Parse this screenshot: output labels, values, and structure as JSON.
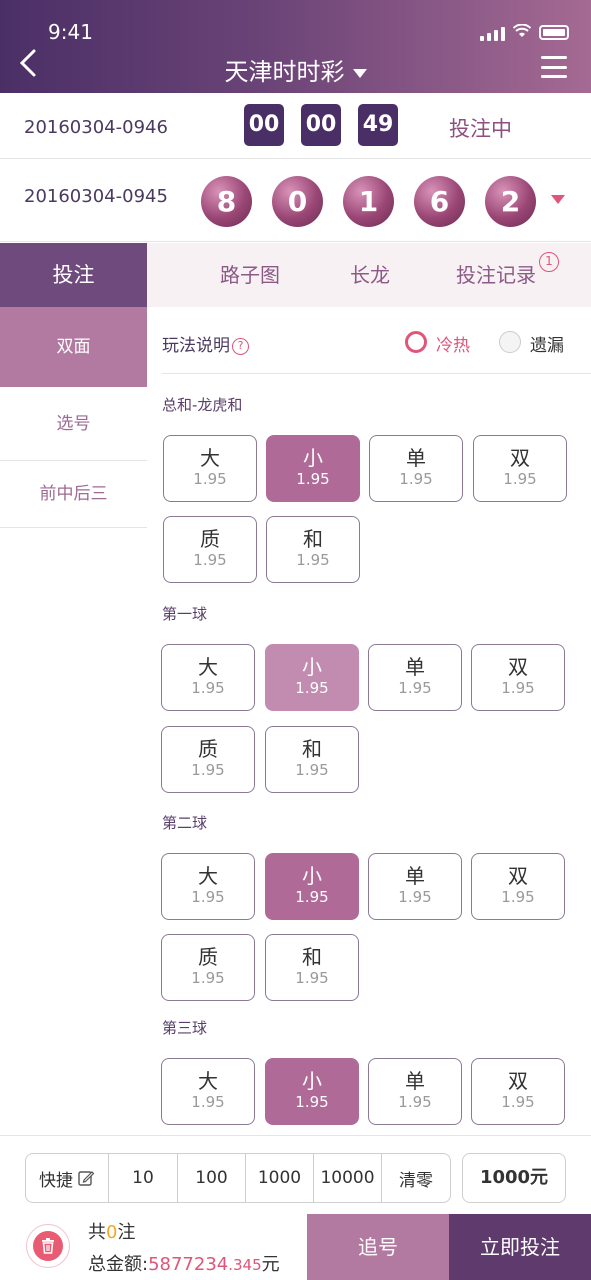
{
  "status_bar": {
    "time": "9:41"
  },
  "header": {
    "title": "天津时时彩"
  },
  "countdown": {
    "issue": "20160304-0946",
    "hours": "00",
    "minutes": "00",
    "seconds": "49",
    "status": "投注中"
  },
  "last_draw": {
    "issue": "20160304-0945",
    "balls": [
      "8",
      "0",
      "1",
      "6",
      "2"
    ]
  },
  "tabs": {
    "active": "投注",
    "items": [
      "路子图",
      "长龙",
      "投注记录"
    ],
    "badge": "1"
  },
  "sidebar": {
    "items": [
      "双面",
      "选号",
      "前中后三"
    ]
  },
  "options": {
    "rules": "玩法说明",
    "hot_cold": "冷热",
    "missing": "遗漏"
  },
  "sections": [
    {
      "title": "总和-龙虎和",
      "bets": [
        {
          "name": "大",
          "odds": "1.95"
        },
        {
          "name": "小",
          "odds": "1.95"
        },
        {
          "name": "单",
          "odds": "1.95"
        },
        {
          "name": "双",
          "odds": "1.95"
        },
        {
          "name": "质",
          "odds": "1.95"
        },
        {
          "name": "和",
          "odds": "1.95"
        }
      ]
    },
    {
      "title": "第一球",
      "bets": [
        {
          "name": "大",
          "odds": "1.95"
        },
        {
          "name": "小",
          "odds": "1.95"
        },
        {
          "name": "单",
          "odds": "1.95"
        },
        {
          "name": "双",
          "odds": "1.95"
        },
        {
          "name": "质",
          "odds": "1.95"
        },
        {
          "name": "和",
          "odds": "1.95"
        }
      ]
    },
    {
      "title": "第二球",
      "bets": [
        {
          "name": "大",
          "odds": "1.95"
        },
        {
          "name": "小",
          "odds": "1.95"
        },
        {
          "name": "单",
          "odds": "1.95"
        },
        {
          "name": "双",
          "odds": "1.95"
        },
        {
          "name": "质",
          "odds": "1.95"
        },
        {
          "name": "和",
          "odds": "1.95"
        }
      ]
    },
    {
      "title": "第三球",
      "bets": [
        {
          "name": "大",
          "odds": "1.95"
        },
        {
          "name": "小",
          "odds": "1.95"
        },
        {
          "name": "单",
          "odds": "1.95"
        },
        {
          "name": "双",
          "odds": "1.95"
        }
      ]
    }
  ],
  "quick_bet": {
    "label": "快捷",
    "amounts": [
      "10",
      "100",
      "1000",
      "10000"
    ],
    "clear": "清零",
    "current_amount": "1000元"
  },
  "summary": {
    "count_prefix": "共",
    "count": "0",
    "count_suffix": "注",
    "total_label": "总金额:",
    "total_int": "5877234",
    "total_dec": ".345",
    "currency": "元"
  },
  "actions": {
    "chase": "追号",
    "bet_now": "立即投注"
  },
  "colors": {
    "primary": "#6f4a7d",
    "accent": "#e0557a",
    "selected": "#b06a98"
  }
}
